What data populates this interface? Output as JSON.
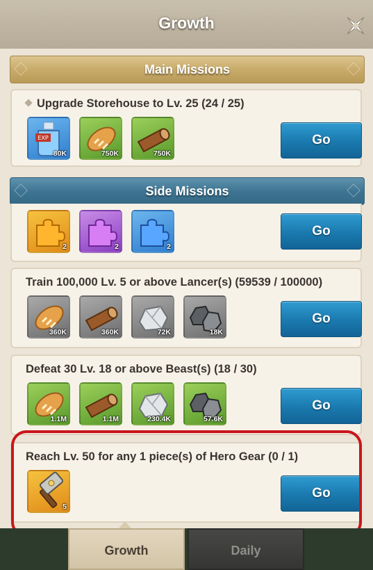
{
  "header": {
    "title": "Growth",
    "close_icon": "close-x-icon"
  },
  "sections": {
    "main_missions": {
      "label": "Main Missions"
    },
    "side_missions": {
      "label": "Side Missions"
    }
  },
  "missions": [
    {
      "title": "Upgrade Storehouse to Lv. 25 (24 / 25)",
      "go_label": "Go",
      "rewards": [
        {
          "icon": "exp-potion-icon",
          "qty": "80K"
        },
        {
          "icon": "bread-icon",
          "qty": "750K"
        },
        {
          "icon": "wood-log-icon",
          "qty": "750K"
        }
      ]
    },
    {
      "title": "",
      "go_label": "Go",
      "rewards": [
        {
          "icon": "orange-puzzle-icon",
          "qty": "2"
        },
        {
          "icon": "purple-puzzle-icon",
          "qty": "2"
        },
        {
          "icon": "blue-puzzle-icon",
          "qty": "2"
        }
      ]
    },
    {
      "title": "Train 100,000 Lv. 5 or above Lancer(s) (59539 / 100000)",
      "go_label": "Go",
      "rewards": [
        {
          "icon": "bread-icon",
          "qty": "360K"
        },
        {
          "icon": "wood-log-icon",
          "qty": "360K"
        },
        {
          "icon": "stone-icon",
          "qty": "72K"
        },
        {
          "icon": "iron-ore-icon",
          "qty": "18K"
        }
      ]
    },
    {
      "title": "Defeat 30 Lv. 18 or above Beast(s) (18 / 30)",
      "go_label": "Go",
      "rewards": [
        {
          "icon": "bread-icon",
          "qty": "1.1M"
        },
        {
          "icon": "wood-log-icon",
          "qty": "1.1M"
        },
        {
          "icon": "stone-icon",
          "qty": "230.4K"
        },
        {
          "icon": "iron-ore-icon",
          "qty": "57.6K"
        }
      ]
    },
    {
      "title": "Reach Lv. 50 for any 1 piece(s) of Hero Gear (0 / 1)",
      "go_label": "Go",
      "rewards": [
        {
          "icon": "hammer-icon",
          "qty": "5"
        }
      ]
    }
  ],
  "tabs": [
    {
      "label": "Growth",
      "active": true
    },
    {
      "label": "Daily",
      "active": false
    }
  ],
  "colors": {
    "accent_blue": "#1a79ae",
    "highlight_red": "#c8161b",
    "panel_bg": "#ece4d6"
  }
}
